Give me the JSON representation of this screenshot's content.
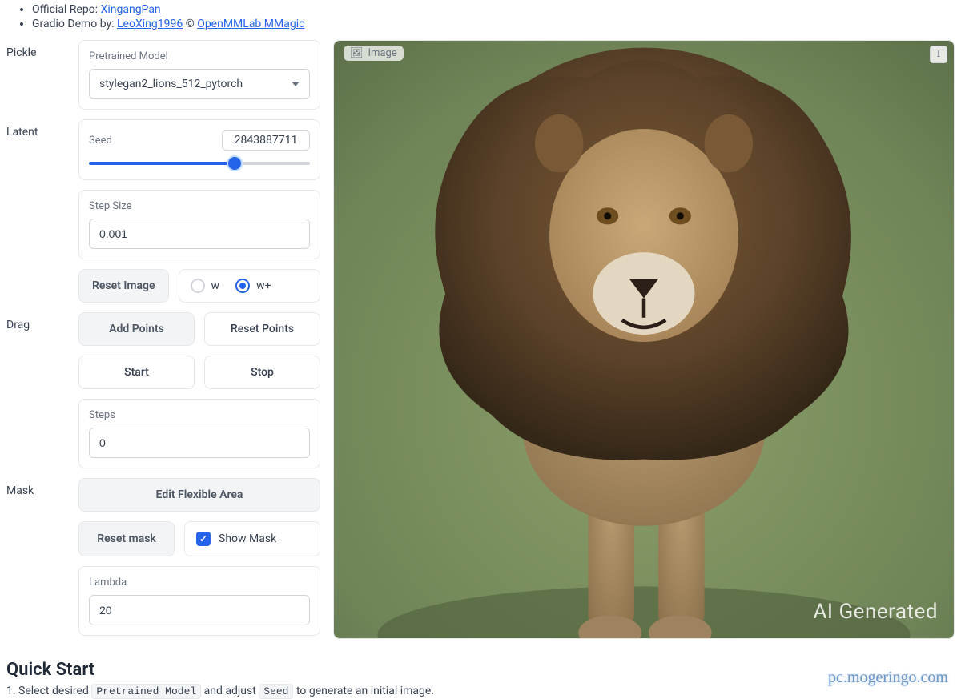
{
  "header": {
    "repo_label": "Official Repo:",
    "repo_link": "XingangPan",
    "demo_label": "Gradio Demo by:",
    "demo_author": "LeoXing1996",
    "copyright": "©",
    "demo_org": "OpenMMLab MMagic"
  },
  "sections": {
    "pickle": {
      "label": "Pickle"
    },
    "latent": {
      "label": "Latent"
    },
    "drag": {
      "label": "Drag"
    },
    "mask": {
      "label": "Mask"
    }
  },
  "pretrained": {
    "label": "Pretrained Model",
    "selected": "stylegan2_lions_512_pytorch"
  },
  "seed": {
    "label": "Seed",
    "value": "2843887711",
    "slider_percent": 66
  },
  "step_size": {
    "label": "Step Size",
    "value": "0.001"
  },
  "buttons": {
    "reset_image": "Reset Image",
    "add_points": "Add Points",
    "reset_points": "Reset Points",
    "start": "Start",
    "stop": "Stop",
    "edit_flexible": "Edit Flexible Area",
    "reset_mask": "Reset mask"
  },
  "latent_space": {
    "options": [
      "w",
      "w+"
    ],
    "selected": "w+"
  },
  "steps": {
    "label": "Steps",
    "value": "0"
  },
  "show_mask": {
    "label": "Show Mask",
    "checked": true
  },
  "lambda": {
    "label": "Lambda",
    "value": "20"
  },
  "image": {
    "label": "Image",
    "watermark": "AI Generated"
  },
  "quick_start": {
    "title": "Quick Start",
    "step1_pre": "1. Select desired",
    "step1_code1": "Pretrained Model",
    "step1_mid": "and adjust",
    "step1_code2": "Seed",
    "step1_post": "to generate an initial image."
  },
  "page_watermark": "pc.mogeringo.com"
}
